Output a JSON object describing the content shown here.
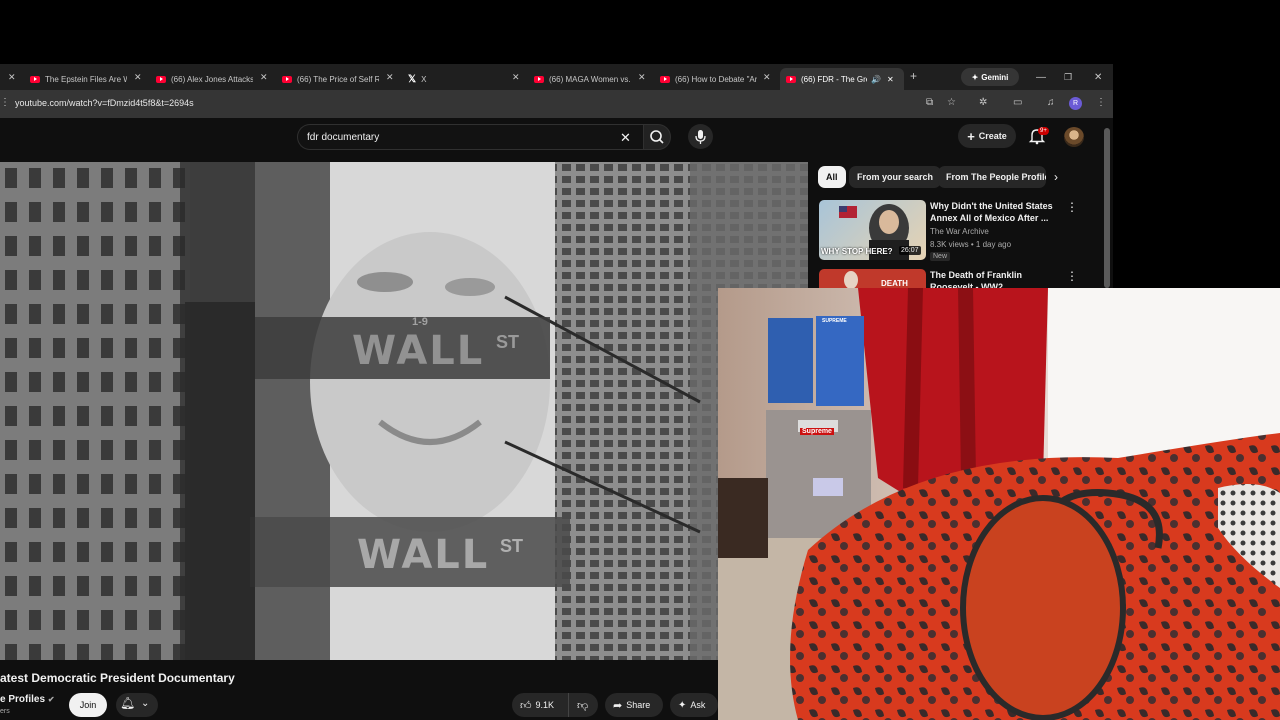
{
  "browser": {
    "tabs": [
      {
        "title": "The Epstein Files Are W"
      },
      {
        "title": "(66) Alex Jones Attacks"
      },
      {
        "title": "(66) The Price of Self Re"
      },
      {
        "title": "X"
      },
      {
        "title": "(66) MAGA Women vs."
      },
      {
        "title": "(66) How to Debate \"An"
      },
      {
        "title": "(66) FDR - The Grea"
      }
    ],
    "new_tab": "+",
    "gemini_label": "Gemini",
    "url": "youtube.com/watch?v=fDmzid4t5f8&t=2694s"
  },
  "youtube": {
    "search_query": "fdr documentary",
    "create_label": "Create",
    "notification_badge": "9+",
    "video": {
      "overlay_sign_1": "WALL",
      "overlay_sign_1_sup": "ST",
      "overlay_sign_2": "WALL",
      "overlay_sign_2_sup": "ST",
      "sign_number": "1-9",
      "title": "atest Democratic President Documentary",
      "channel": "e Profiles",
      "subs": "ers",
      "join_label": "Join",
      "likes": "9.1K",
      "share_label": "Share",
      "ask_label": "Ask"
    },
    "chips": [
      "All",
      "From your search",
      "From The People Profile"
    ],
    "recommendations": [
      {
        "title": "Why Didn't the United States Annex All of Mexico After ...",
        "channel": "The War Archive",
        "meta": "8.3K views • 1 day ago",
        "badge": "New",
        "duration": "26:07",
        "thumb_text": "WHY STOP HERE?"
      },
      {
        "title": "The Death of Franklin Roosevelt - WW2 Documentary Special",
        "thumb_text": "DEATH"
      }
    ]
  },
  "webcam": {
    "box_label_1": "SUPREME",
    "box_label_2": "Supreme"
  },
  "colors": {
    "brand_red": "#ff0033",
    "bg": "#0f0f0f"
  }
}
